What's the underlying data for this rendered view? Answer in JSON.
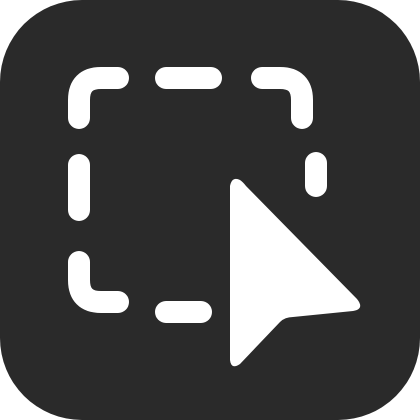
{
  "icon": {
    "name": "screenshot-selection-app-icon",
    "glyphs": [
      "dashed-selection-rectangle-icon",
      "cursor-arrow-icon"
    ]
  },
  "colors": {
    "tile_background": "#2a2a2a",
    "glyph": "#ffffff",
    "page_background": "#ffffff"
  }
}
